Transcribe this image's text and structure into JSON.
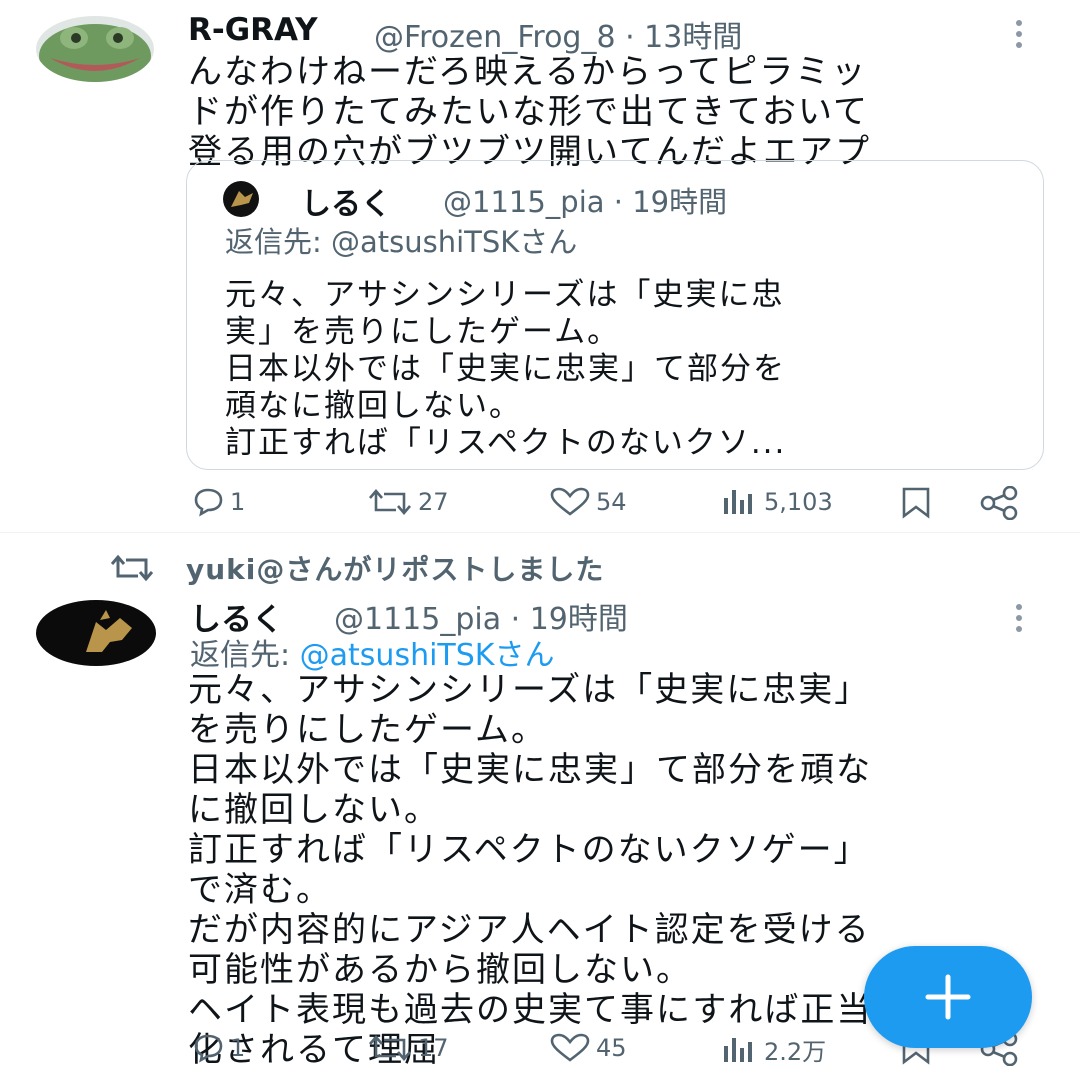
{
  "tweet1": {
    "display_name": "R-GRAY",
    "handle_time": "@Frozen_Frog_8 · 13時間",
    "text_lines": [
      "んなわけねーだろ映えるからってピラミッ",
      "ドが作りたてみたいな形で出てきておいて",
      "登る用の穴がブツブツ開いてんだよエアプ"
    ],
    "quote": {
      "display_name": "しるく",
      "handle_time": "@1115_pia · 19時間",
      "reply_to": "返信先: @atsushiTSKさん",
      "text_lines": [
        "元々、アサシンシリーズは「史実に忠",
        "実」を売りにしたゲーム。",
        "日本以外では「史実に忠実」て部分を",
        "頑なに撤回しない。",
        "訂正すれば「リスペクトのないクソ..."
      ]
    },
    "actions": {
      "replies": "1",
      "reposts": "27",
      "likes": "54",
      "views": "5,103"
    }
  },
  "repost_banner": {
    "text": "yuki@さんがリポストしました"
  },
  "tweet2": {
    "display_name": "しるく",
    "handle_time": "@1115_pia · 19時間",
    "reply_prefix": "返信先: ",
    "reply_handle": "@atsushiTSKさん",
    "text_lines": [
      "元々、アサシンシリーズは「史実に忠実」",
      "を売りにしたゲーム。",
      "日本以外では「史実に忠実」て部分を頑な",
      "に撤回しない。",
      "訂正すれば「リスペクトのないクソゲー」",
      "で済む。",
      "だが内容的にアジア人ヘイト認定を受ける",
      "可能性があるから撤回しない。",
      "ヘイト表現も過去の史実て事にすれば正当",
      "化されるて理屈"
    ],
    "actions": {
      "replies": "1",
      "reposts": "17",
      "likes": "45",
      "views": "2.2万"
    }
  },
  "colors": {
    "accent": "#1d9bf0",
    "secondary_text": "#536471",
    "border": "#cfd9de"
  },
  "icons": [
    "reply-icon",
    "repost-icon",
    "like-icon",
    "views-icon",
    "bookmark-icon",
    "share-icon",
    "more-icon",
    "compose-plus-icon"
  ]
}
